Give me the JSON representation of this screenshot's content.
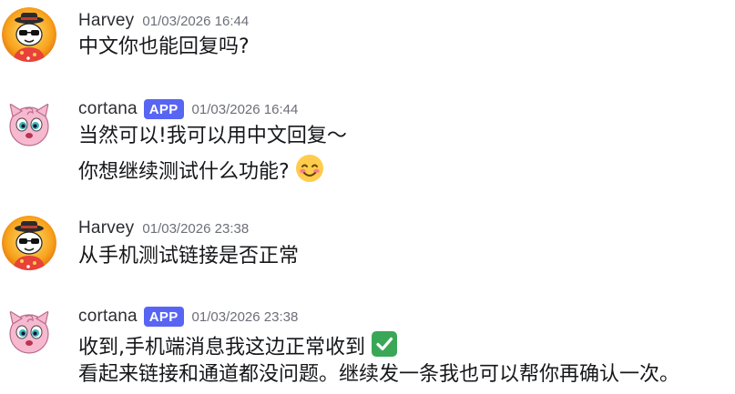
{
  "messages": [
    {
      "author": "Harvey",
      "is_app": false,
      "timestamp": "01/03/2026 16:44",
      "lines": [
        "中文你也能回复吗?"
      ]
    },
    {
      "author": "cortana",
      "is_app": true,
      "badge": "APP",
      "timestamp": "01/03/2026 16:44",
      "lines": [
        "当然可以!我可以用中文回复～",
        "你想继续测试什么功能?"
      ],
      "emoji": "smiling-blush-emoji"
    },
    {
      "author": "Harvey",
      "is_app": false,
      "timestamp": "01/03/2026 23:38",
      "lines": [
        "从手机测试链接是否正常"
      ]
    },
    {
      "author": "cortana",
      "is_app": true,
      "badge": "APP",
      "timestamp": "01/03/2026 23:38",
      "lines": [
        "收到,手机端消息我这边正常收到",
        "看起来链接和通道都没问题。继续发一条我也可以帮你再确认一次。"
      ],
      "emoji": "check-mark-button-emoji"
    }
  ],
  "colors": {
    "app_badge": "#5865f2",
    "check_emoji": "#3aa757",
    "timestamp": "#6d6f78"
  }
}
